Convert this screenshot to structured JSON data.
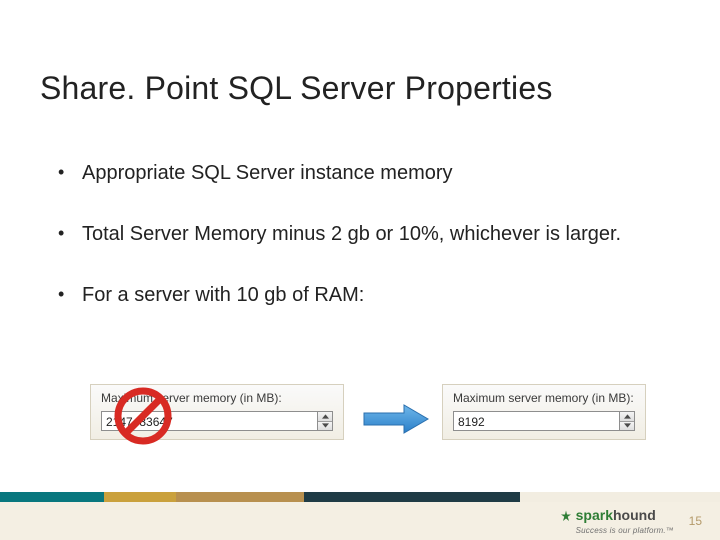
{
  "title": "Share. Point SQL Server Properties",
  "bullets": [
    "Appropriate SQL Server instance memory",
    "Total Server Memory minus 2 gb or 10%, whichever is larger.",
    "For a server with 10 gb of RAM:"
  ],
  "memory_left": {
    "label": "Maximum server memory (in MB):",
    "value": "2147483647"
  },
  "memory_right": {
    "label": "Maximum server memory (in MB):",
    "value": "8192"
  },
  "footer": {
    "brand_spark": "spark",
    "brand_hound": "hound",
    "tagline": "Success is our platform.™",
    "page": "15"
  },
  "colors": {
    "brand_green": "#2e7d35",
    "no_symbol": "#d82a23",
    "arrow_fill": "#4aa0e6"
  }
}
